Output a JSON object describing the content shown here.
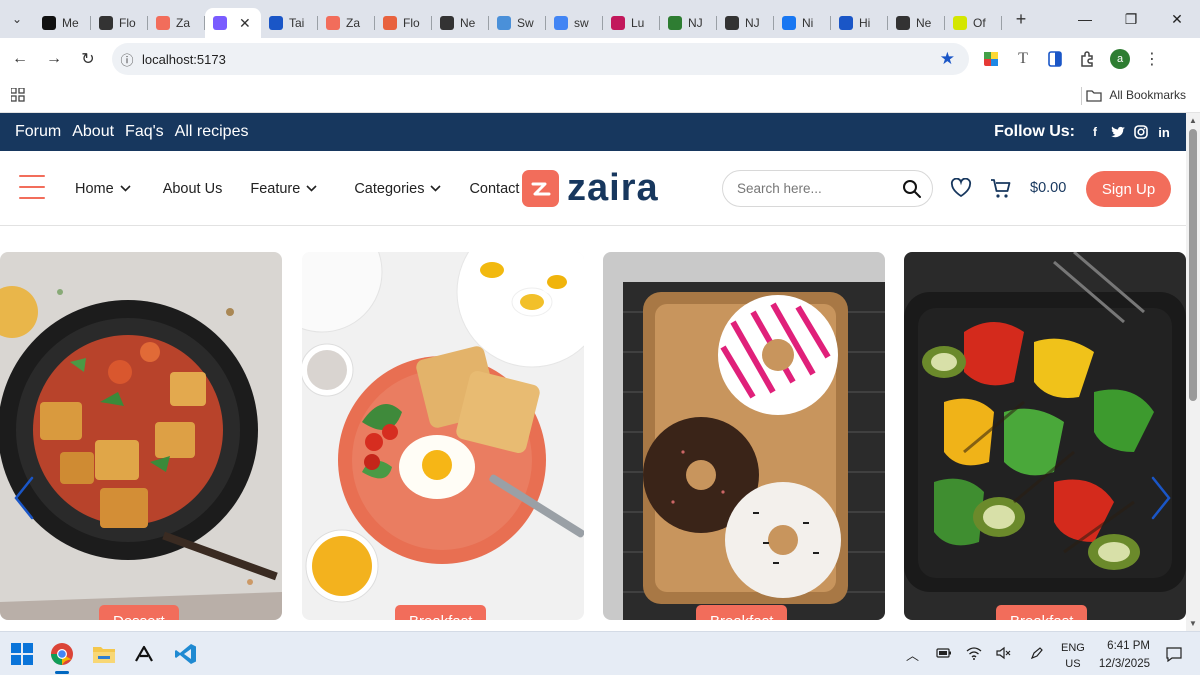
{
  "browser": {
    "tabs": [
      {
        "label": "Me",
        "color": "#111111"
      },
      {
        "label": "Flo",
        "color": "#333333"
      },
      {
        "label": "Za",
        "color": "#f26d5b"
      },
      {
        "label": "",
        "color": "#7a5cff",
        "active": true
      },
      {
        "label": "Tai",
        "color": "#1a56c7"
      },
      {
        "label": "Za",
        "color": "#f26d5b"
      },
      {
        "label": "Flo",
        "color": "#e8623e"
      },
      {
        "label": "Ne",
        "color": "#333333"
      },
      {
        "label": "Sw",
        "color": "#4a90d9"
      },
      {
        "label": "sw",
        "color": "#4285f4"
      },
      {
        "label": "Lu",
        "color": "#c2185b"
      },
      {
        "label": "NJ",
        "color": "#2e7d32"
      },
      {
        "label": "NJ",
        "color": "#333333"
      },
      {
        "label": "Ni",
        "color": "#1877f2"
      },
      {
        "label": "Hi",
        "color": "#1a56c7"
      },
      {
        "label": "Ne",
        "color": "#333333"
      },
      {
        "label": "Of",
        "color": "#d4e600"
      }
    ],
    "url": "localhost:5173",
    "profile_initial": "a",
    "bookmarks_label": "All Bookmarks"
  },
  "topbar": {
    "links": [
      "Forum",
      "About",
      "Faq's",
      "All recipes"
    ],
    "follow_label": "Follow Us:",
    "social_icons": [
      "facebook-icon",
      "twitter-icon",
      "instagram-icon",
      "linkedin-icon"
    ]
  },
  "header": {
    "menu": [
      {
        "label": "Home",
        "dropdown": true
      },
      {
        "label": "About Us",
        "dropdown": false
      },
      {
        "label": "Feature",
        "dropdown": true
      },
      {
        "label": "Categories",
        "dropdown": true
      },
      {
        "label": "Contact",
        "dropdown": false
      }
    ],
    "logo_text": "zaira",
    "search_placeholder": "Search here...",
    "cart_total": "$0.00",
    "signup_label": "Sign Up"
  },
  "slider": {
    "cards": [
      {
        "tag": "Dessert",
        "image": "stir-fry-tofu-bowl"
      },
      {
        "tag": "Breakfast",
        "image": "egg-toast-plate"
      },
      {
        "tag": "Breakfast",
        "image": "donuts-tray"
      },
      {
        "tag": "Breakfast",
        "image": "grilled-vegetables-pan"
      }
    ]
  },
  "taskbar": {
    "apps": [
      "windows-start-icon",
      "chrome-icon",
      "file-explorer-icon",
      "acrobat-icon",
      "vscode-icon"
    ],
    "lang_line1": "ENG",
    "lang_line2": "US",
    "time": "6:41 PM",
    "date": "12/3/2025"
  },
  "colors": {
    "brand_navy": "#17375e",
    "brand_coral": "#f26d5b",
    "arrow_blue": "#1a56c7"
  }
}
